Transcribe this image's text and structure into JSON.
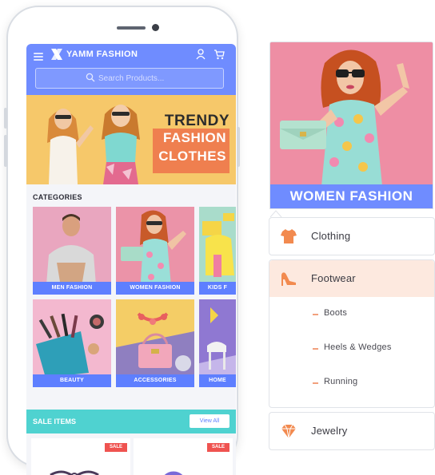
{
  "app": {
    "brand": "YAMM FASHION",
    "search_placeholder": "Search Products..."
  },
  "hero": {
    "line1": "TRENDY",
    "line2": "FASHION",
    "line3": "CLOTHES"
  },
  "categories": {
    "title": "CATEGORIES",
    "items": [
      {
        "label": "MEN FASHION"
      },
      {
        "label": "WOMEN FASHION"
      },
      {
        "label": "KIDS F"
      },
      {
        "label": "BEAUTY"
      },
      {
        "label": "ACCESSORIES"
      },
      {
        "label": "HOME"
      }
    ]
  },
  "sale": {
    "title": "SALE ITEMS",
    "view_all": "View All",
    "badge": "SALE"
  },
  "panel": {
    "feature_label": "WOMEN FASHION",
    "menu": [
      {
        "label": "Clothing",
        "icon": "shirt-icon"
      },
      {
        "label": "Footwear",
        "icon": "heel-icon",
        "subitems": [
          "Boots",
          "Heels & Wedges",
          "Running"
        ]
      },
      {
        "label": "Jewelry",
        "icon": "gem-icon"
      }
    ]
  },
  "colors": {
    "primary": "#6f8cff",
    "accent": "#ef7f4f",
    "sale": "#4fd2d0",
    "highlight": "#fde9df"
  }
}
